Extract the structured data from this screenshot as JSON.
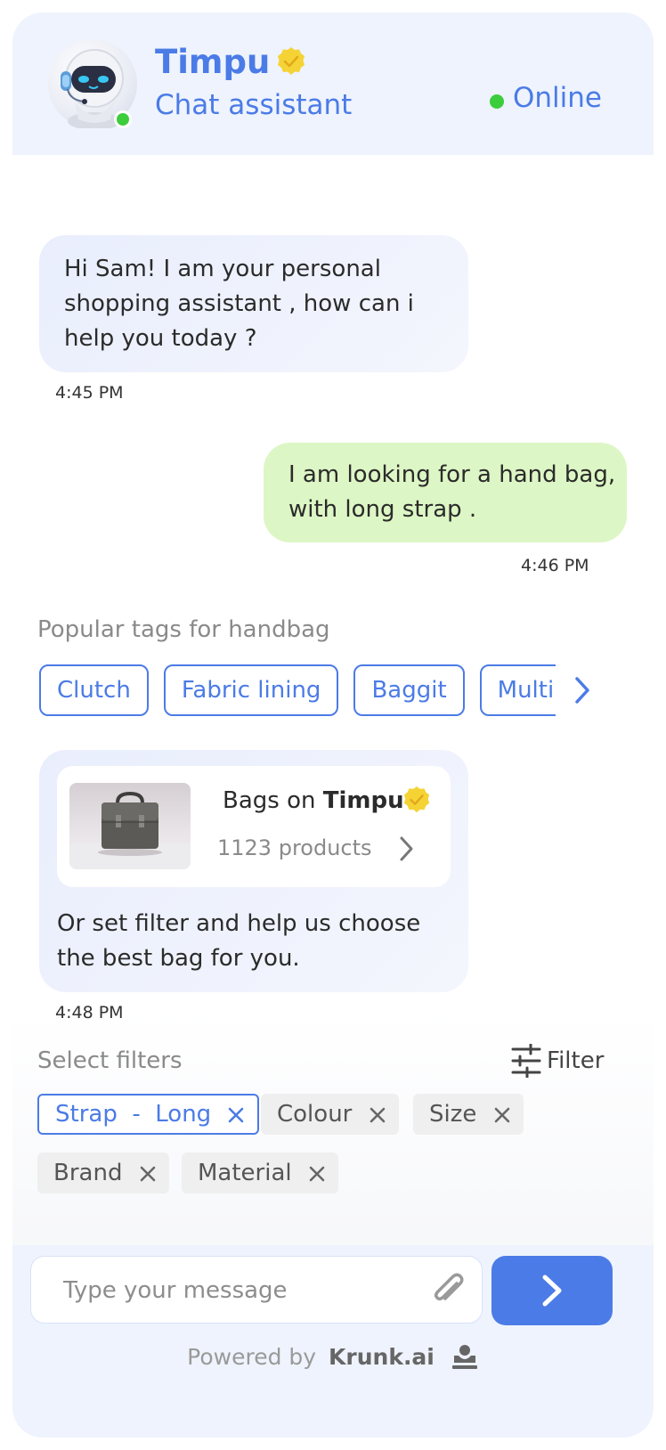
{
  "header": {
    "bot_name": "Timpu",
    "bot_role": "Chat assistant",
    "status": "Online"
  },
  "messages": [
    {
      "from": "bot",
      "text": "Hi Sam! I am your personal shopping assistant , how can i help you today ?",
      "time": "4:45 PM"
    },
    {
      "from": "user",
      "text": "I am looking for a hand bag, with long strap .",
      "time": "4:46 PM"
    }
  ],
  "tags": {
    "label": "Popular tags for handbag",
    "items": [
      "Clutch",
      "Fabric lining",
      "Baggit",
      "Multi"
    ]
  },
  "product_message": {
    "card_prefix": "Bags on ",
    "card_brand": "Timpu",
    "count": "1123 products",
    "text": "Or set filter and help us choose the best bag for you.",
    "time": "4:48 PM"
  },
  "filters": {
    "label": "Select filters",
    "button": "Filter",
    "chips": [
      {
        "label": "Strap  -  Long",
        "active": true
      },
      {
        "label": "Colour",
        "active": false
      },
      {
        "label": "Size",
        "active": false
      },
      {
        "label": "Brand",
        "active": false
      },
      {
        "label": "Material",
        "active": false
      }
    ]
  },
  "composer": {
    "placeholder": "Type your message",
    "powered_by": "Powered by",
    "brand": "Krunk.ai"
  },
  "colors": {
    "accent": "#4b7be6",
    "online": "#3ccd3c",
    "user_bubble": "#ddf6c5",
    "bot_bubble": "#eaeffd",
    "verified": "#f5d335"
  },
  "icons": [
    "robot-avatar",
    "verified-badge-icon",
    "chevron-right-icon",
    "filter-sliders-icon",
    "close-icon",
    "paperclip-icon",
    "send-arrow-icon",
    "krunk-logo-icon"
  ]
}
